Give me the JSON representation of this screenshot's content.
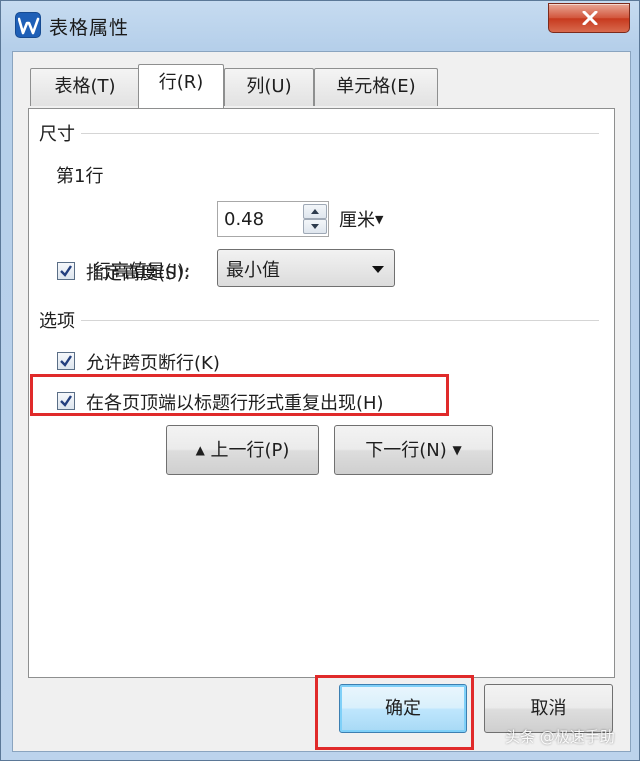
{
  "window": {
    "title": "表格属性",
    "close_icon": "close-icon"
  },
  "tabs": [
    {
      "label": "表格(T)"
    },
    {
      "label": "行(R)"
    },
    {
      "label": "列(U)"
    },
    {
      "label": "单元格(E)"
    }
  ],
  "active_tab": 1,
  "size_section": {
    "label": "尺寸",
    "row_label": "第1行",
    "height_checkbox": {
      "label": "指定高度(S):",
      "checked": true
    },
    "height_value": "0.48",
    "unit": "厘米",
    "row_height_is_label": "行高值是(I):",
    "row_height_mode": "最小值"
  },
  "options_section": {
    "label": "选项",
    "allow_break": {
      "label": "允许跨页断行(K)",
      "checked": true
    },
    "repeat_header": {
      "label": "在各页顶端以标题行形式重复出现(H)",
      "checked": true
    }
  },
  "nav": {
    "prev_label": "上一行(P)",
    "next_label": "下一行(N)"
  },
  "footer": {
    "ok_label": "确定",
    "cancel_label": "取消"
  },
  "annotation_color": "#e02a2a",
  "watermark": "头条 @极速手助"
}
